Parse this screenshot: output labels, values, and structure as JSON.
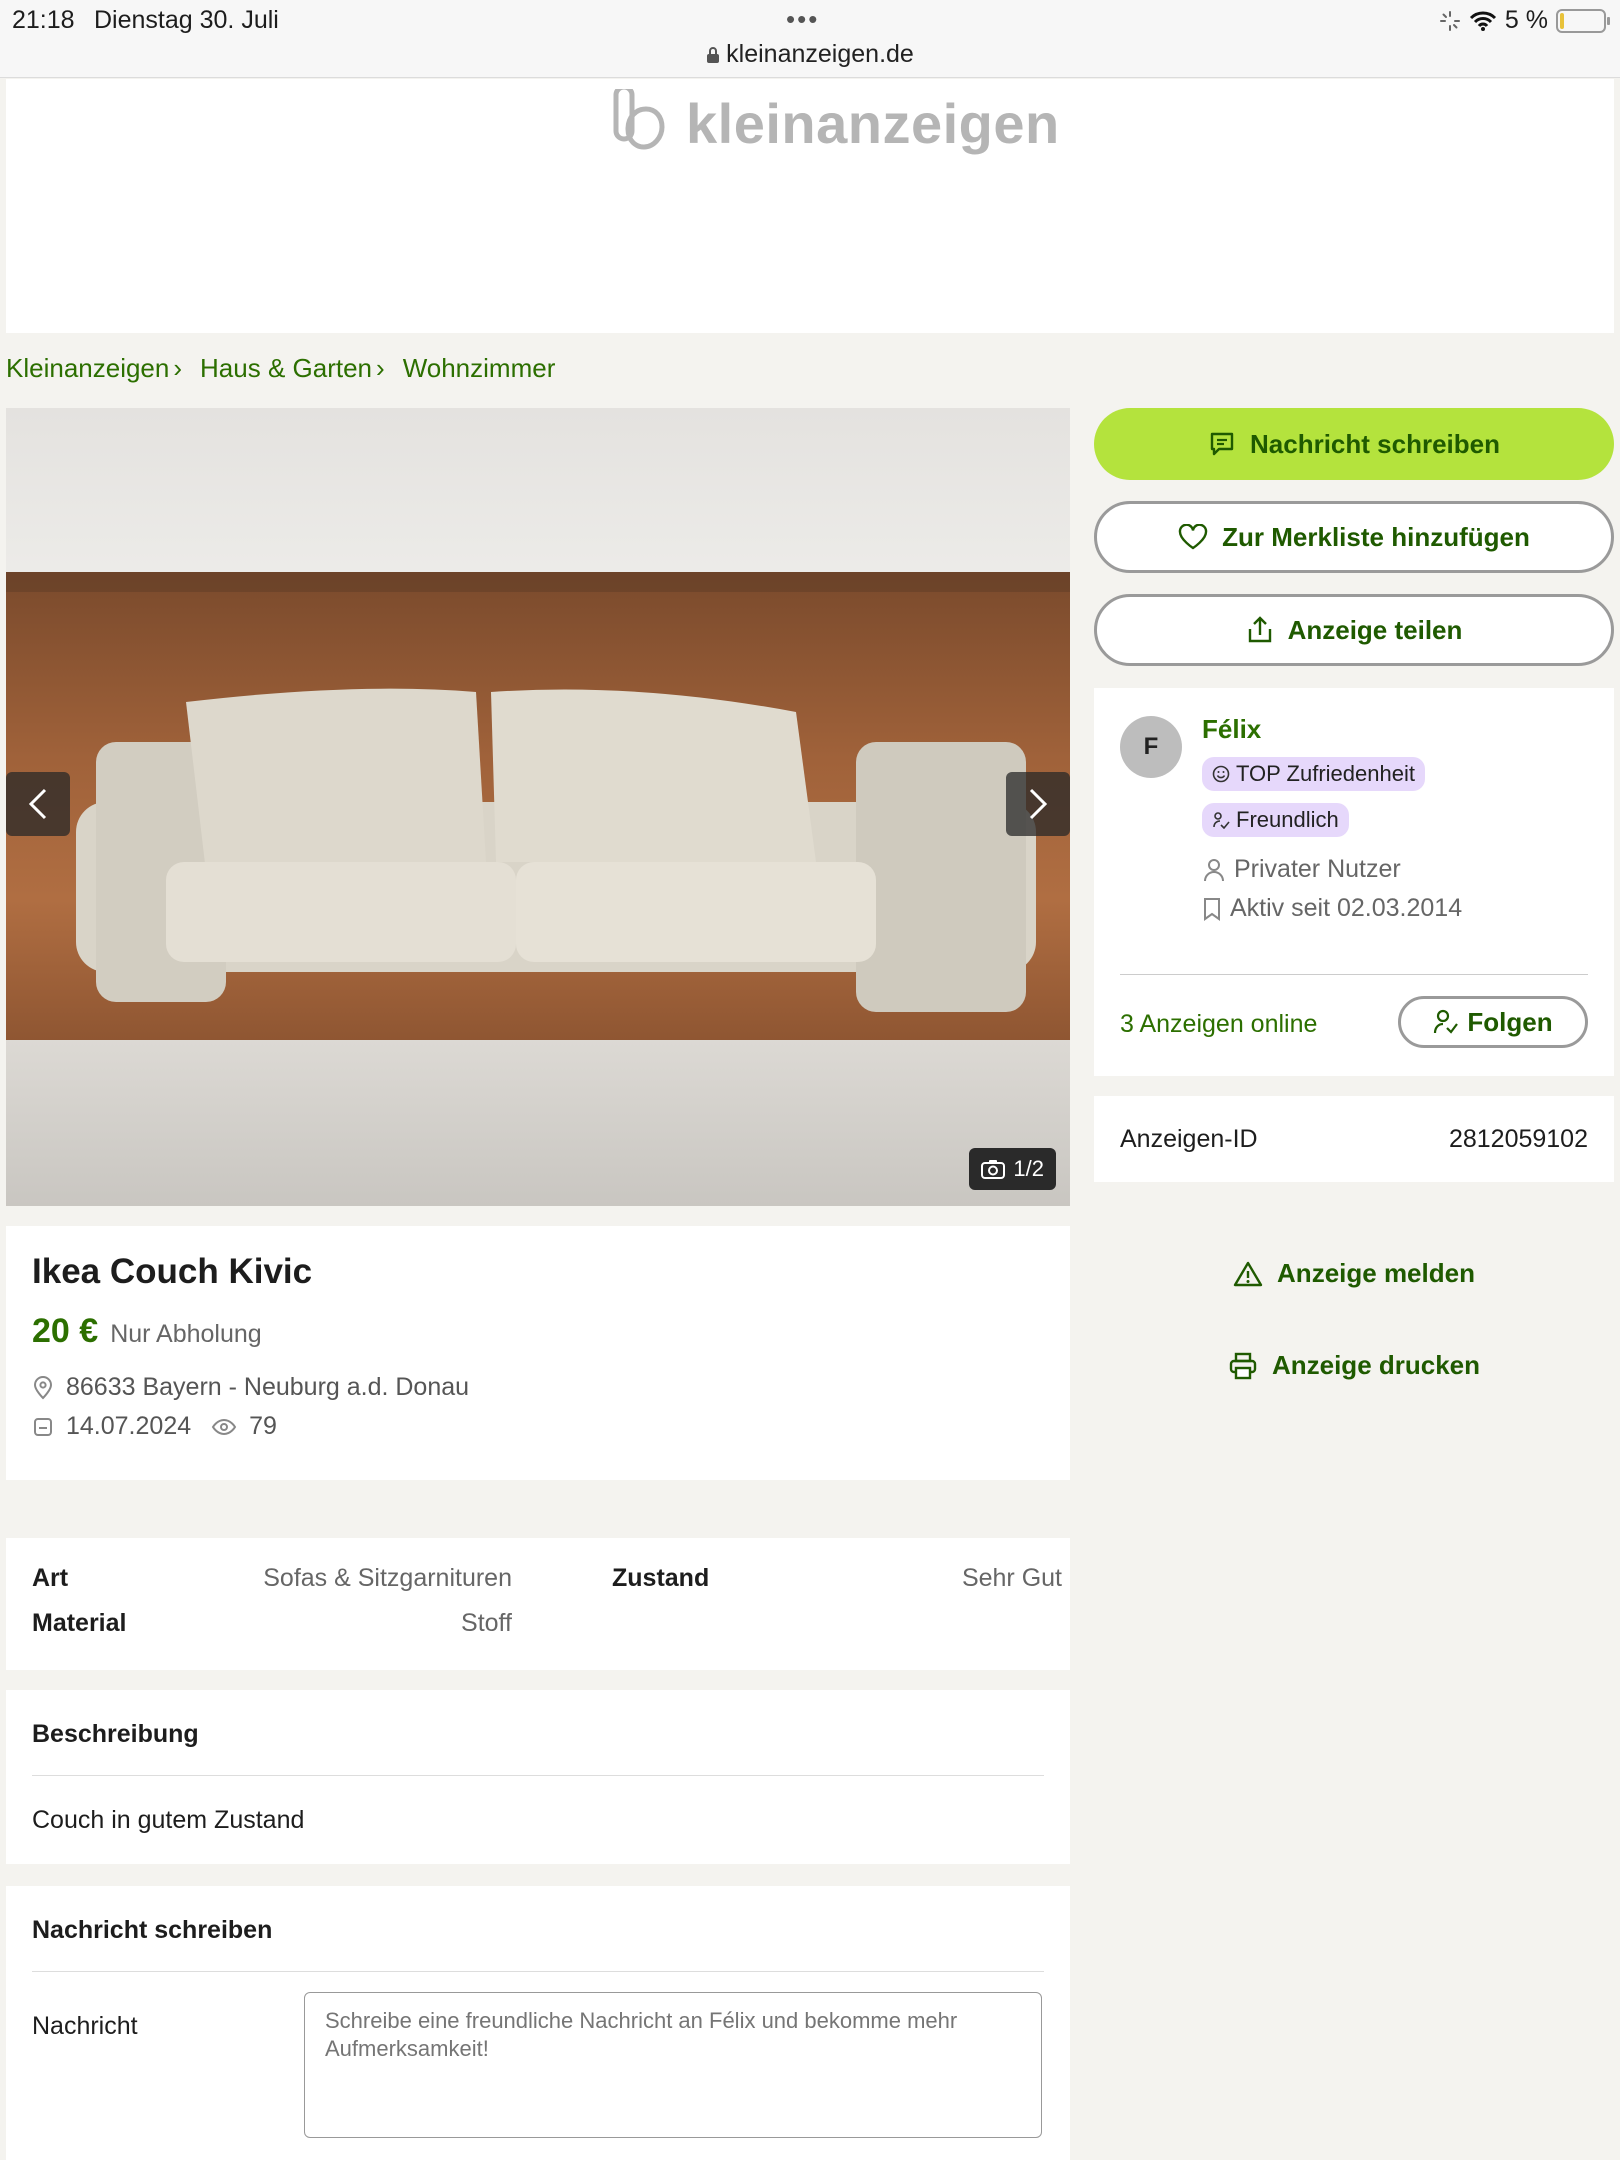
{
  "status_bar": {
    "time": "21:18",
    "date": "Dienstag 30. Juli",
    "url": "kleinanzeigen.de",
    "battery": "5 %"
  },
  "header": {
    "logo_text": "kleinanzeigen"
  },
  "breadcrumb": {
    "items": [
      "Kleinanzeigen",
      "Haus & Garten",
      "Wohnzimmer"
    ]
  },
  "gallery": {
    "counter": "1/2"
  },
  "ad": {
    "title": "Ikea Couch Kivic",
    "price": "20 €",
    "shipping": "Nur Abholung",
    "location": "86633 Bayern - Neuburg a.d. Donau",
    "date": "14.07.2024",
    "views": "79"
  },
  "attributes": {
    "art_label": "Art",
    "art_value": "Sofas & Sitzgarnituren",
    "zustand_label": "Zustand",
    "zustand_value": "Sehr Gut",
    "material_label": "Material",
    "material_value": "Stoff"
  },
  "description": {
    "title": "Beschreibung",
    "text": "Couch in gutem Zustand"
  },
  "message": {
    "title": "Nachricht schreiben",
    "label": "Nachricht",
    "placeholder": "Schreibe eine freundliche Nachricht an Félix und bekomme mehr Aufmerksamkeit!"
  },
  "actions": {
    "message_button": "Nachricht schreiben",
    "favorite_button": "Zur Merkliste hinzufügen",
    "share_button": "Anzeige teilen",
    "report_link": "Anzeige melden",
    "print_link": "Anzeige drucken"
  },
  "seller": {
    "initial": "F",
    "name": "Félix",
    "badge_satisfaction": "TOP Zufriedenheit",
    "badge_friendly": "Freundlich",
    "type": "Privater Nutzer",
    "active_since": "Aktiv seit 02.03.2014",
    "ads_online": "3 Anzeigen online",
    "follow_button": "Folgen"
  },
  "ad_id": {
    "label": "Anzeigen-ID",
    "value": "2812059102"
  },
  "colors": {
    "accent_green": "#2c6f00",
    "primary_button": "#b4e33d",
    "badge_purple": "#e6d8fb",
    "background": "#f4f3ef"
  }
}
